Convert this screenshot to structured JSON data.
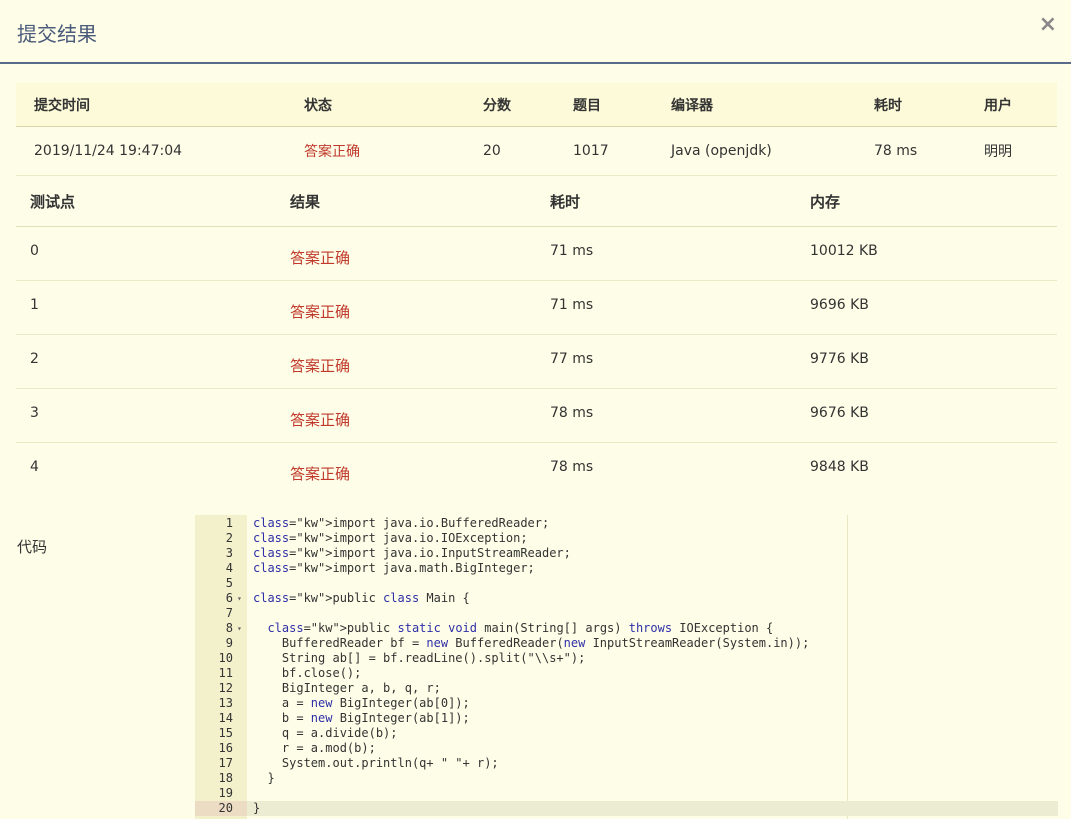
{
  "dialog": {
    "title": "提交结果",
    "close_glyph": "×"
  },
  "summary": {
    "headers": {
      "time": "提交时间",
      "status": "状态",
      "score": "分数",
      "problem": "题目",
      "compiler": "编译器",
      "elapsed": "耗时",
      "user": "用户"
    },
    "row": {
      "time": "2019/11/24 19:47:04",
      "status": "答案正确",
      "score": "20",
      "problem": "1017",
      "compiler": "Java (openjdk)",
      "elapsed": "78 ms",
      "user": "明明"
    }
  },
  "tests": {
    "headers": {
      "point": "测试点",
      "result": "结果",
      "elapsed": "耗时",
      "memory": "内存"
    },
    "rows": [
      {
        "point": "0",
        "result": "答案正确",
        "elapsed": "71 ms",
        "memory": "10012 KB"
      },
      {
        "point": "1",
        "result": "答案正确",
        "elapsed": "71 ms",
        "memory": "9696 KB"
      },
      {
        "point": "2",
        "result": "答案正确",
        "elapsed": "77 ms",
        "memory": "9776 KB"
      },
      {
        "point": "3",
        "result": "答案正确",
        "elapsed": "78 ms",
        "memory": "9676 KB"
      },
      {
        "point": "4",
        "result": "答案正确",
        "elapsed": "78 ms",
        "memory": "9848 KB"
      }
    ]
  },
  "code": {
    "label": "代码",
    "fold_glyph": "▾",
    "active_line": 20,
    "lines": [
      "import java.io.BufferedReader;",
      "import java.io.IOException;",
      "import java.io.InputStreamReader;",
      "import java.math.BigInteger;",
      "",
      "public class Main {",
      "",
      "  public static void main(String[] args) throws IOException {",
      "    BufferedReader bf = new BufferedReader(new InputStreamReader(System.in));",
      "    String ab[] = bf.readLine().split(\"\\\\s+\");",
      "    bf.close();",
      "    BigInteger a, b, q, r;",
      "    a = new BigInteger(ab[0]);",
      "    b = new BigInteger(ab[1]);",
      "    q = a.divide(b);",
      "    r = a.mod(b);",
      "    System.out.println(q+ \" \"+ r);",
      "  }",
      "",
      "}"
    ],
    "fold_lines": [
      6,
      8
    ],
    "colors": {
      "keyword": "#2f2fa8",
      "accepted": "#c0392b"
    }
  }
}
